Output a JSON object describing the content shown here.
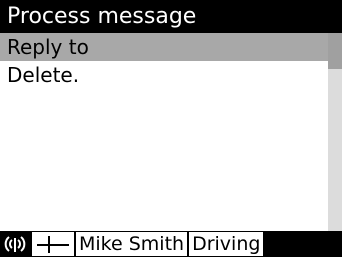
{
  "title": "Process message",
  "menu": {
    "items": [
      {
        "label": "Reply to",
        "selected": true
      },
      {
        "label": "Delete.",
        "selected": false
      }
    ]
  },
  "status_bar": {
    "icons": [
      "broadcast-icon",
      "antenna-icon"
    ],
    "contact": "Mike Smith",
    "status": "Driving"
  },
  "colors": {
    "title_bg": "#000000",
    "title_fg": "#ffffff",
    "selection": "#a8a8a8",
    "status_bg": "#000000"
  }
}
